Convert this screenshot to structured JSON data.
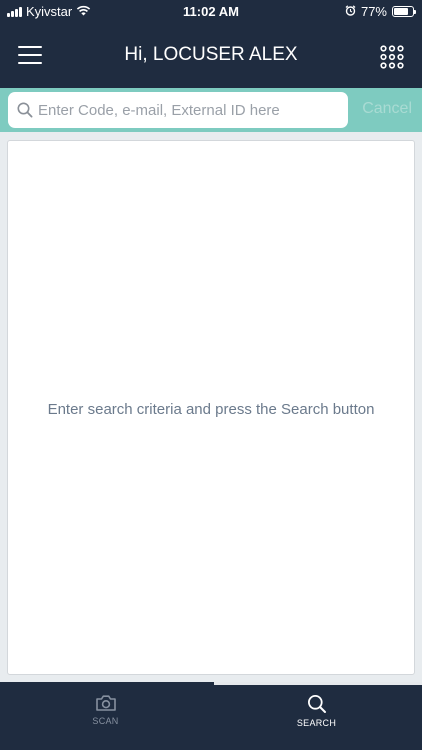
{
  "status_bar": {
    "carrier": "Kyivstar",
    "time": "11:02 AM",
    "battery_percent": "77%",
    "battery_level": 0.77,
    "icons": [
      "signal-icon",
      "wifi-icon",
      "alarm-icon",
      "battery-icon"
    ]
  },
  "header": {
    "title": "Hi, LOCUSER ALEX",
    "menu_icon": "hamburger-menu-icon",
    "apps_icon": "grid-apps-icon"
  },
  "search": {
    "placeholder": "Enter Code, e-mail, External ID here",
    "value": "",
    "cancel_label": "Cancel",
    "icon": "search-icon"
  },
  "results": {
    "empty_message": "Enter search criteria and press the Search button"
  },
  "tabs": [
    {
      "label": "SCAN",
      "icon": "camera-icon",
      "active": false
    },
    {
      "label": "SEARCH",
      "icon": "search-icon",
      "active": true
    }
  ],
  "colors": {
    "header_bg": "#1f2c40",
    "search_bar_bg": "#7ecbc0",
    "cancel_text": "#a9dbd3",
    "content_bg": "#e8ecef",
    "message_text": "#6b7a8c"
  }
}
